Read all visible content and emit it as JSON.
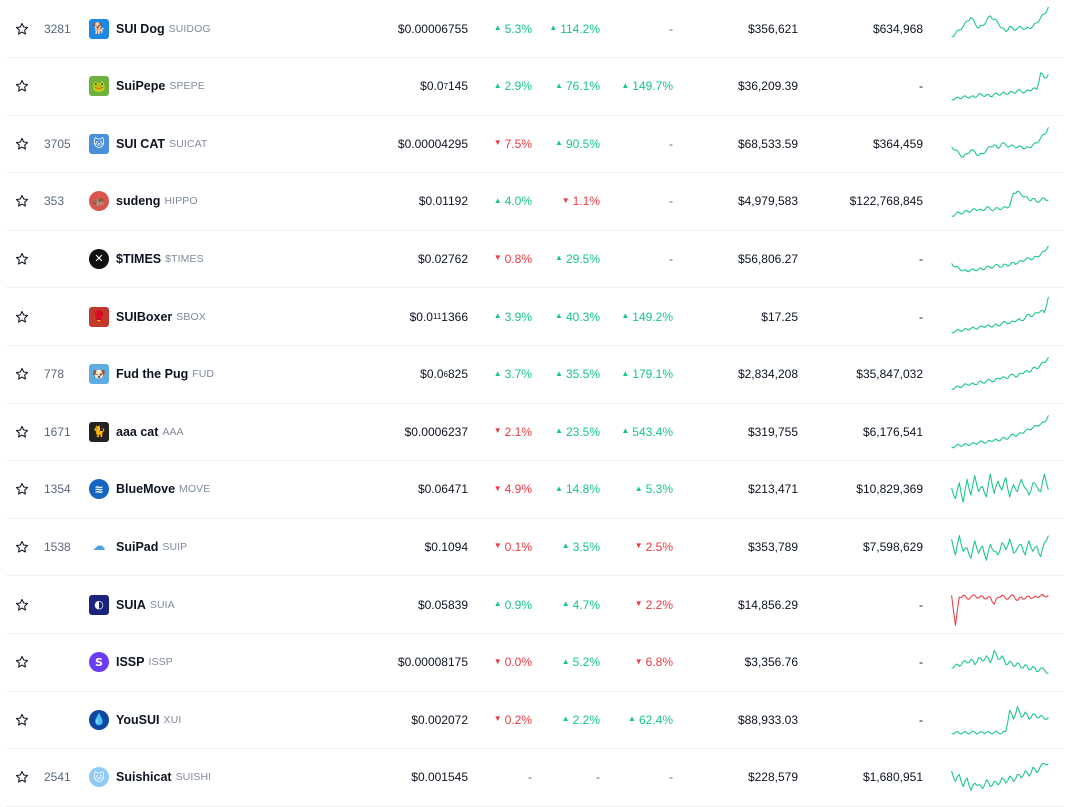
{
  "colors": {
    "up": "#16c784",
    "down": "#ea3943",
    "neutral": "#58667e"
  },
  "rows": [
    {
      "rank": "3281",
      "name": "SUI Dog",
      "symbol": "SUIDOG",
      "price": "$0.00006755",
      "price_parts": null,
      "change_1h": {
        "text": "5.3%",
        "dir": "up"
      },
      "change_24h": {
        "text": "114.2%",
        "dir": "up"
      },
      "change_7d": {
        "text": "-",
        "dir": "none"
      },
      "volume": "$356,621",
      "market_cap": "$634,968",
      "logo": {
        "icon": "dog-logo-icon",
        "bg": "#1e88e5",
        "glyph": "🐕",
        "round": false
      },
      "sparkline": {
        "color": "#16c784",
        "points": [
          30,
          26,
          22,
          18,
          12,
          8,
          14,
          20,
          17,
          12,
          6,
          10,
          14,
          20,
          24,
          18,
          22,
          20,
          19,
          21,
          20,
          18,
          14,
          8,
          4,
          -4
        ]
      }
    },
    {
      "rank": "",
      "name": "SuiPepe",
      "symbol": "SPEPE",
      "price": "$0.07145",
      "price_parts": {
        "lead": "$0.0",
        "sub": "7",
        "tail": "145"
      },
      "change_1h": {
        "text": "2.9%",
        "dir": "up"
      },
      "change_24h": {
        "text": "76.1%",
        "dir": "up"
      },
      "change_7d": {
        "text": "149.7%",
        "dir": "up"
      },
      "volume": "$36,209.39",
      "market_cap": "-",
      "logo": {
        "icon": "pepe-frog-logo-icon",
        "bg": "#6fb03f",
        "glyph": "🐸",
        "round": false
      },
      "sparkline": {
        "color": "#16c784",
        "points": [
          36,
          35,
          35,
          33,
          34,
          33,
          34,
          30,
          32,
          31,
          33,
          30,
          31,
          29,
          30,
          28,
          29,
          26,
          27,
          28,
          26,
          24,
          25,
          6,
          12,
          8
        ]
      }
    },
    {
      "rank": "3705",
      "name": "SUI CAT",
      "symbol": "SUICAT",
      "price": "$0.00004295",
      "price_parts": null,
      "change_1h": {
        "text": "7.5%",
        "dir": "down"
      },
      "change_24h": {
        "text": "90.5%",
        "dir": "up"
      },
      "change_7d": {
        "text": "-",
        "dir": "none"
      },
      "volume": "$68,533.59",
      "market_cap": "$364,459",
      "logo": {
        "icon": "cat-logo-icon",
        "bg": "#4a90d9",
        "glyph": "🐱",
        "round": false
      },
      "sparkline": {
        "color": "#16c784",
        "points": [
          24,
          28,
          32,
          36,
          32,
          28,
          30,
          34,
          32,
          28,
          24,
          22,
          26,
          20,
          22,
          24,
          23,
          25,
          24,
          26,
          25,
          22,
          20,
          14,
          10,
          2
        ]
      }
    },
    {
      "rank": "353",
      "name": "sudeng",
      "symbol": "HIPPO",
      "price": "$0.01192",
      "price_parts": null,
      "change_1h": {
        "text": "4.0%",
        "dir": "up"
      },
      "change_24h": {
        "text": "1.1%",
        "dir": "down"
      },
      "change_7d": {
        "text": "-",
        "dir": "none"
      },
      "volume": "$4,979,583",
      "market_cap": "$122,768,845",
      "logo": {
        "icon": "hippo-logo-icon",
        "bg": "#d9534f",
        "glyph": "🦛",
        "round": true
      },
      "sparkline": {
        "color": "#16c784",
        "points": [
          38,
          36,
          34,
          35,
          32,
          33,
          30,
          31,
          32,
          28,
          30,
          31,
          29,
          30,
          28,
          27,
          12,
          10,
          14,
          16,
          20,
          18,
          22,
          20,
          18,
          20
        ]
      }
    },
    {
      "rank": "",
      "name": "$TIMES",
      "symbol": "$TIMES",
      "price": "$0.02762",
      "price_parts": null,
      "change_1h": {
        "text": "0.8%",
        "dir": "down"
      },
      "change_24h": {
        "text": "29.5%",
        "dir": "up"
      },
      "change_7d": {
        "text": "-",
        "dir": "none"
      },
      "volume": "$56,806.27",
      "market_cap": "-",
      "logo": {
        "icon": "x-circle-logo-icon",
        "bg": "#111111",
        "glyph": "✕",
        "round": true
      },
      "sparkline": {
        "color": "#16c784",
        "points": [
          26,
          30,
          32,
          34,
          35,
          33,
          34,
          32,
          33,
          30,
          31,
          29,
          28,
          30,
          27,
          28,
          25,
          26,
          23,
          22,
          20,
          21,
          18,
          16,
          12,
          6
        ]
      }
    },
    {
      "rank": "",
      "name": "SUIBoxer",
      "symbol": "SBOX",
      "price": "$0.0111366",
      "price_parts": {
        "lead": "$0.0",
        "sub": "11",
        "tail": "1366"
      },
      "change_1h": {
        "text": "3.9%",
        "dir": "up"
      },
      "change_24h": {
        "text": "40.3%",
        "dir": "up"
      },
      "change_7d": {
        "text": "149.2%",
        "dir": "up"
      },
      "volume": "$17.25",
      "market_cap": "-",
      "logo": {
        "icon": "boxer-logo-icon",
        "bg": "#c0392b",
        "glyph": "🥊",
        "round": false
      },
      "sparkline": {
        "color": "#16c784",
        "points": [
          38,
          37,
          36,
          36,
          35,
          34,
          34,
          33,
          32,
          31,
          32,
          30,
          31,
          28,
          27,
          28,
          26,
          24,
          25,
          22,
          18,
          20,
          16,
          14,
          16,
          -2
        ]
      }
    },
    {
      "rank": "778",
      "name": "Fud the Pug",
      "symbol": "FUD",
      "price": "$0.06825",
      "price_parts": {
        "lead": "$0.0",
        "sub": "6",
        "tail": "825"
      },
      "change_1h": {
        "text": "3.7%",
        "dir": "up"
      },
      "change_24h": {
        "text": "35.5%",
        "dir": "up"
      },
      "change_7d": {
        "text": "179.1%",
        "dir": "up"
      },
      "volume": "$2,834,208",
      "market_cap": "$35,847,032",
      "logo": {
        "icon": "pug-logo-icon",
        "bg": "#5dade2",
        "glyph": "🐶",
        "round": false
      },
      "sparkline": {
        "color": "#16c784",
        "points": [
          38,
          36,
          36,
          34,
          33,
          32,
          33,
          30,
          31,
          29,
          28,
          29,
          26,
          25,
          26,
          23,
          22,
          24,
          20,
          18,
          19,
          14,
          15,
          10,
          8,
          2
        ]
      }
    },
    {
      "rank": "1671",
      "name": "aaa cat",
      "symbol": "AAA",
      "price": "$0.0006237",
      "price_parts": null,
      "change_1h": {
        "text": "2.1%",
        "dir": "down"
      },
      "change_24h": {
        "text": "23.5%",
        "dir": "up"
      },
      "change_7d": {
        "text": "543.4%",
        "dir": "up"
      },
      "volume": "$319,755",
      "market_cap": "$6,176,541",
      "logo": {
        "icon": "black-cat-logo-icon",
        "bg": "#222222",
        "glyph": "🐈",
        "round": false
      },
      "sparkline": {
        "color": "#16c784",
        "points": [
          38,
          37,
          36,
          36,
          35,
          35,
          34,
          33,
          32,
          33,
          31,
          30,
          31,
          28,
          29,
          26,
          24,
          25,
          22,
          20,
          18,
          16,
          14,
          12,
          10,
          2
        ]
      }
    },
    {
      "rank": "1354",
      "name": "BlueMove",
      "symbol": "MOVE",
      "price": "$0.06471",
      "price_parts": null,
      "change_1h": {
        "text": "4.9%",
        "dir": "down"
      },
      "change_24h": {
        "text": "14.8%",
        "dir": "up"
      },
      "change_7d": {
        "text": "5.3%",
        "dir": "up"
      },
      "volume": "$213,471",
      "market_cap": "$10,829,369",
      "logo": {
        "icon": "wave-logo-icon",
        "bg": "#1565c0",
        "glyph": "≋",
        "round": true
      },
      "sparkline": {
        "color": "#16c784",
        "points": [
          20,
          32,
          14,
          36,
          10,
          28,
          6,
          24,
          18,
          30,
          4,
          26,
          12,
          22,
          8,
          30,
          16,
          24,
          10,
          20,
          28,
          14,
          18,
          24,
          4,
          22
        ]
      }
    },
    {
      "rank": "1538",
      "name": "SuiPad",
      "symbol": "SUIP",
      "price": "$0.1094",
      "price_parts": null,
      "change_1h": {
        "text": "0.1%",
        "dir": "down"
      },
      "change_24h": {
        "text": "3.5%",
        "dir": "up"
      },
      "change_7d": {
        "text": "2.5%",
        "dir": "down"
      },
      "volume": "$353,789",
      "market_cap": "$7,598,629",
      "logo": {
        "icon": "cloud-logo-icon",
        "bg": "#ffffff",
        "glyph": "☁",
        "round": true
      },
      "sparkline": {
        "color": "#16c784",
        "points": [
          12,
          30,
          8,
          26,
          22,
          34,
          14,
          28,
          20,
          36,
          18,
          26,
          30,
          16,
          24,
          12,
          28,
          22,
          18,
          30,
          14,
          26,
          20,
          32,
          16,
          8
        ]
      }
    },
    {
      "rank": "",
      "name": "SUIA",
      "symbol": "SUIA",
      "price": "$0.05839",
      "price_parts": null,
      "change_1h": {
        "text": "0.9%",
        "dir": "up"
      },
      "change_24h": {
        "text": "4.7%",
        "dir": "up"
      },
      "change_7d": {
        "text": "2.2%",
        "dir": "down"
      },
      "volume": "$14,856.29",
      "market_cap": "-",
      "logo": {
        "icon": "suia-logo-icon",
        "bg": "#1a237e",
        "glyph": "◐",
        "round": false
      },
      "sparkline": {
        "color": "#ea3943",
        "points": [
          10,
          44,
          12,
          10,
          14,
          12,
          10,
          13,
          11,
          14,
          12,
          20,
          12,
          10,
          14,
          12,
          10,
          16,
          12,
          14,
          11,
          13,
          12,
          10,
          11,
          10
        ]
      }
    },
    {
      "rank": "",
      "name": "ISSP",
      "symbol": "ISSP",
      "price": "$0.00008175",
      "price_parts": null,
      "change_1h": {
        "text": "0.0%",
        "dir": "down"
      },
      "change_24h": {
        "text": "5.2%",
        "dir": "up"
      },
      "change_7d": {
        "text": "6.8%",
        "dir": "down"
      },
      "volume": "$3,356.76",
      "market_cap": "-",
      "logo": {
        "icon": "s-letter-logo-icon",
        "bg": "#6a3df5",
        "glyph": "S",
        "round": true
      },
      "sparkline": {
        "color": "#16c784",
        "points": [
          28,
          24,
          26,
          20,
          22,
          18,
          24,
          16,
          20,
          14,
          22,
          8,
          18,
          14,
          24,
          20,
          26,
          22,
          28,
          24,
          30,
          26,
          32,
          28,
          30,
          34
        ]
      }
    },
    {
      "rank": "",
      "name": "YouSUI",
      "symbol": "XUI",
      "price": "$0.002072",
      "price_parts": null,
      "change_1h": {
        "text": "0.2%",
        "dir": "down"
      },
      "change_24h": {
        "text": "2.2%",
        "dir": "up"
      },
      "change_7d": {
        "text": "62.4%",
        "dir": "up"
      },
      "volume": "$88,933.03",
      "market_cap": "-",
      "logo": {
        "icon": "water-drop-logo-icon",
        "bg": "#0d47a1",
        "glyph": "💧",
        "round": true
      },
      "sparkline": {
        "color": "#16c784",
        "points": [
          36,
          35,
          36,
          35,
          36,
          35,
          35,
          36,
          35,
          35,
          36,
          35,
          35,
          36,
          34,
          10,
          20,
          6,
          18,
          12,
          20,
          14,
          18,
          16,
          20,
          18
        ]
      }
    },
    {
      "rank": "2541",
      "name": "Suishicat",
      "symbol": "SUISHI",
      "price": "$0.001545",
      "price_parts": null,
      "change_1h": {
        "text": "-",
        "dir": "none"
      },
      "change_24h": {
        "text": "-",
        "dir": "none"
      },
      "change_7d": {
        "text": "-",
        "dir": "none"
      },
      "volume": "$228,579",
      "market_cap": "$1,680,951",
      "logo": {
        "icon": "sushi-cat-logo-icon",
        "bg": "#90caf9",
        "glyph": "🐱",
        "round": true
      },
      "sparkline": {
        "color": "#16c784",
        "points": [
          14,
          26,
          18,
          32,
          22,
          36,
          28,
          30,
          34,
          24,
          32,
          26,
          30,
          22,
          28,
          20,
          26,
          18,
          22,
          14,
          20,
          10,
          16,
          8,
          6,
          6
        ]
      }
    }
  ]
}
